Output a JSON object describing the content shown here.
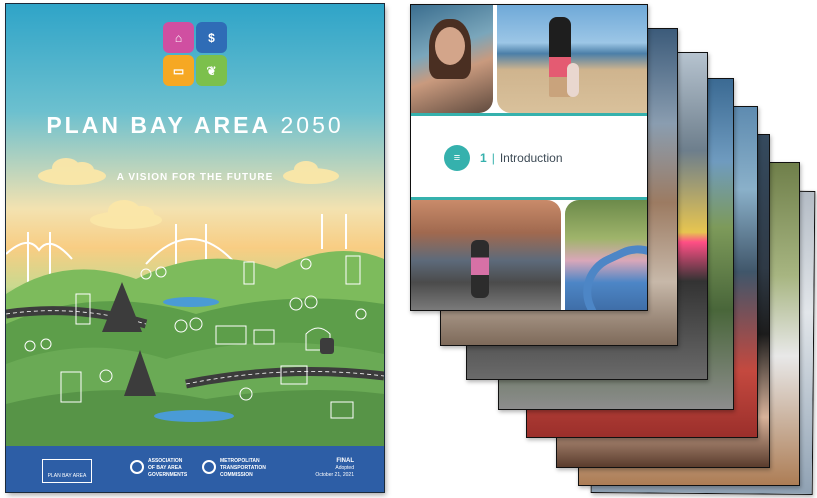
{
  "cover": {
    "title_bold": "PLAN BAY AREA",
    "title_year": "2050",
    "subtitle": "A VISION FOR THE FUTURE",
    "footer": {
      "pba_logo_text": "PLAN BAY AREA 2050",
      "abag_lines": [
        "ASSOCIATION",
        "OF BAY AREA",
        "GOVERNMENTS"
      ],
      "mtc_lines": [
        "METROPOLITAN",
        "TRANSPORTATION",
        "COMMISSION"
      ],
      "status": "FINAL",
      "adopted_label": "Adopted",
      "adopted_date": "October 21, 2021"
    },
    "colors": {
      "footer_blue": "#2d5ea6",
      "logo_pink": "#d04fa1",
      "logo_blue": "#2f6cb6",
      "logo_orange": "#f6a823",
      "logo_green": "#7cc04c"
    },
    "logo_icons": [
      "housing-icon",
      "dollar-icon",
      "bus-icon",
      "leaf-icon"
    ]
  },
  "front_page": {
    "chapter_number": "1",
    "separator": "|",
    "chapter_title": "Introduction",
    "accent_color": "#35b1ad"
  },
  "stack_pages": [
    {
      "accent": "#d9d9d9"
    },
    {
      "accent": "#e8c95a"
    },
    {
      "accent": "#8aa6c9"
    },
    {
      "accent": "#6fae76"
    },
    {
      "accent": "#d16a9a"
    },
    {
      "accent": "#7d6fb7"
    },
    {
      "accent": "#a2a2a2"
    },
    {
      "accent": "#9fc3e3"
    }
  ]
}
